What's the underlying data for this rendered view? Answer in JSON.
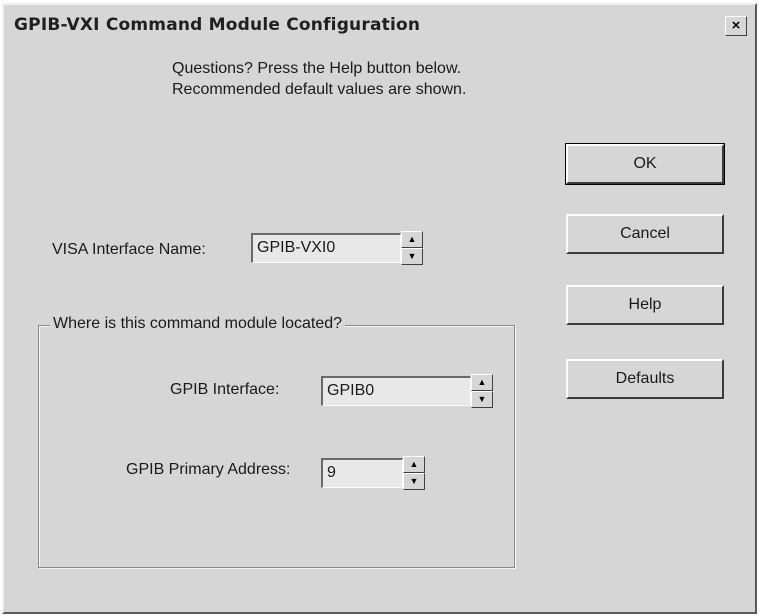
{
  "window": {
    "title": "GPIB-VXI Command Module Configuration",
    "close_label": "×"
  },
  "info": {
    "line1": "Questions?  Press the Help button below.",
    "line2": "Recommended default values are shown."
  },
  "buttons": {
    "ok": "OK",
    "cancel": "Cancel",
    "help": "Help",
    "defaults": "Defaults"
  },
  "visa": {
    "label": "VISA Interface Name:",
    "value": "GPIB-VXI0"
  },
  "location_group": {
    "label": "Where is this command module located?",
    "gpib_interface_label": "GPIB Interface:",
    "gpib_interface_value": "GPIB0",
    "primary_address_label": "GPIB Primary Address:",
    "primary_address_value": "9"
  },
  "spinner": {
    "up_icon": "▲",
    "down_icon": "▼"
  }
}
